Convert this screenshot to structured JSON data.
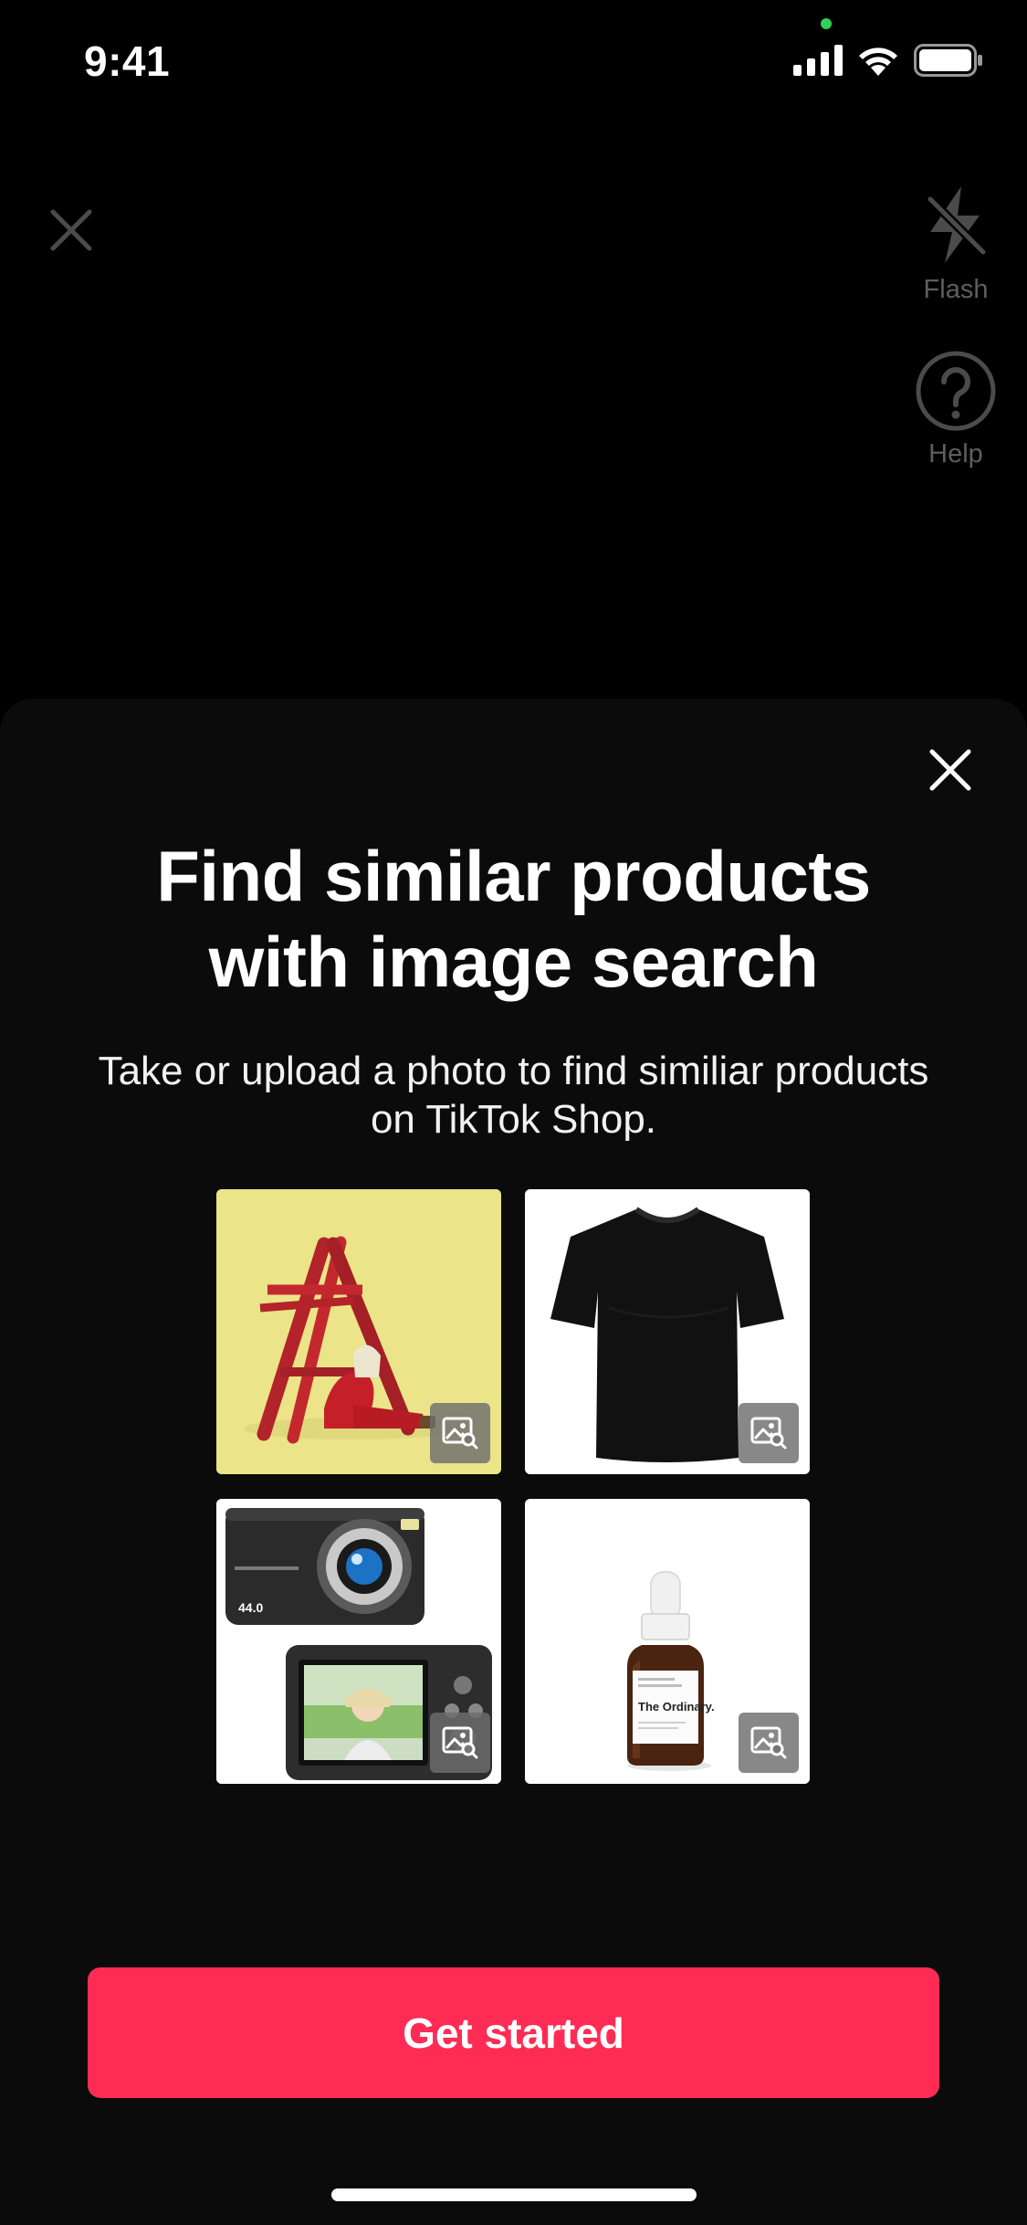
{
  "status_bar": {
    "time": "9:41",
    "icons": [
      "signal-icon",
      "wifi-icon",
      "battery-icon"
    ]
  },
  "camera": {
    "close_icon": "close-icon",
    "flash_label": "Flash",
    "help_label": "Help"
  },
  "sheet": {
    "title_line1": "Find similar products",
    "title_line2": "with image search",
    "subtitle": "Take or upload a photo to find similiar products on TikTok Shop.",
    "examples": [
      {
        "subject": "person with ladder",
        "badge_icon": "image-search-icon"
      },
      {
        "subject": "black t-shirt",
        "badge_icon": "image-search-icon"
      },
      {
        "subject": "digital camera",
        "badge_icon": "image-search-icon",
        "printed_text": "44.0"
      },
      {
        "subject": "serum bottle",
        "badge_icon": "image-search-icon",
        "printed_text": "The Ordinary."
      }
    ],
    "cta_label": "Get started"
  },
  "colors": {
    "background": "#000000",
    "sheet": "#0b0b0b",
    "accent": "#fe2c55",
    "muted": "#5e5e5e"
  }
}
